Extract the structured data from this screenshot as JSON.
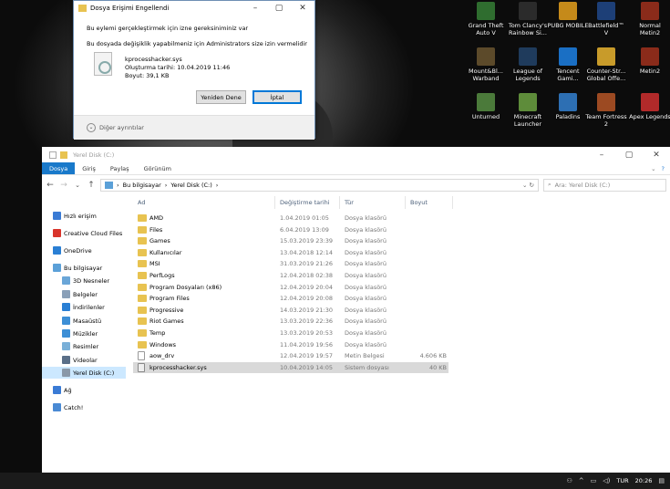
{
  "desktop_icons": [
    {
      "label": "Grand Theft Auto V",
      "color": "#2f6d2f",
      "icon": "gta-icon"
    },
    {
      "label": "Tom Clancy's Rainbow Si...",
      "color": "#2b2b2b",
      "icon": "rainbow-six-icon"
    },
    {
      "label": "PUBG MOBILE",
      "color": "#c58a1a",
      "icon": "pubg-icon"
    },
    {
      "label": "Battlefield™ V",
      "color": "#1d3f77",
      "icon": "battlefield-icon"
    },
    {
      "label": "Normal Metin2",
      "color": "#8a2b1a",
      "icon": "metin2-icon"
    },
    {
      "label": "Mount&Bl... Warband",
      "color": "#5c4a2a",
      "icon": "mount-blade-icon"
    },
    {
      "label": "League of Legends",
      "color": "#1f3b5c",
      "icon": "lol-icon"
    },
    {
      "label": "Tencent Gami...",
      "color": "#1a6fc4",
      "icon": "tencent-icon"
    },
    {
      "label": "Counter-Str... Global Offe...",
      "color": "#c89b2a",
      "icon": "csgo-icon"
    },
    {
      "label": "Metin2",
      "color": "#8a2b1a",
      "icon": "metin2-icon"
    },
    {
      "label": "Unturned",
      "color": "#4b7a3a",
      "icon": "unturned-icon"
    },
    {
      "label": "Minecraft Launcher",
      "color": "#5e8c3a",
      "icon": "minecraft-icon"
    },
    {
      "label": "Paladins",
      "color": "#2d6fb3",
      "icon": "paladins-icon"
    },
    {
      "label": "Team Fortress 2",
      "color": "#9c4a22",
      "icon": "tf2-icon"
    },
    {
      "label": "Apex Legends",
      "color": "#b22a2a",
      "icon": "apex-icon"
    }
  ],
  "dialog": {
    "title": "Dosya Erişimi Engellendi",
    "message1": "Bu eylemi gerçekleştirmek için izne gereksiniminiz var",
    "message2": "Bu dosyada değişiklik yapabilmeniz için Administrators size izin vermelidir",
    "file_name": "kprocesshacker.sys",
    "created": "Oluşturma tarihi: 10.04.2019 11:46",
    "size": "Boyut: 39,1 KB",
    "retry_label": "Yeniden Dene",
    "cancel_label": "İptal",
    "details_label": "Diğer ayrıntılar"
  },
  "explorer": {
    "title": "Yerel Disk (C:)",
    "tabs": [
      "Dosya",
      "Giriş",
      "Paylaş",
      "Görünüm"
    ],
    "breadcrumb": [
      "Bu bilgisayar",
      "Yerel Disk (C:)"
    ],
    "search_placeholder": "Ara: Yerel Disk (C:)",
    "columns": {
      "name": "Ad",
      "date": "Değiştirme tarihi",
      "type": "Tür",
      "size": "Boyut"
    },
    "nav": [
      {
        "label": "Hızlı erişim",
        "color": "#3a7bd5"
      },
      {
        "label": "Creative Cloud Files",
        "color": "#d9342b"
      },
      {
        "label": "OneDrive",
        "color": "#2a7fd4"
      },
      {
        "label": "Bu bilgisayar",
        "color": "#5ba0d8"
      },
      {
        "label": "3D Nesneler",
        "color": "#6aa6d8"
      },
      {
        "label": "Belgeler",
        "color": "#8aa0b8"
      },
      {
        "label": "İndirilenler",
        "color": "#2a7fd4"
      },
      {
        "label": "Masaüstü",
        "color": "#3d8fd6"
      },
      {
        "label": "Müzikler",
        "color": "#3d8fd6"
      },
      {
        "label": "Resimler",
        "color": "#7ab0d8"
      },
      {
        "label": "Videolar",
        "color": "#5a6f88"
      },
      {
        "label": "Yerel Disk (C:)",
        "color": "#8a98a8"
      },
      {
        "label": "Ağ",
        "color": "#3a7bd5"
      },
      {
        "label": "Catch!",
        "color": "#4a8ad4"
      }
    ],
    "files": [
      {
        "name": "AMD",
        "date": "1.04.2019 01:05",
        "type": "Dosya klasörü",
        "size": "",
        "kind": "folder"
      },
      {
        "name": "Files",
        "date": "6.04.2019 13:09",
        "type": "Dosya klasörü",
        "size": "",
        "kind": "folder"
      },
      {
        "name": "Games",
        "date": "15.03.2019 23:39",
        "type": "Dosya klasörü",
        "size": "",
        "kind": "folder"
      },
      {
        "name": "Kullanıcılar",
        "date": "13.04.2018 12:14",
        "type": "Dosya klasörü",
        "size": "",
        "kind": "folder"
      },
      {
        "name": "MSI",
        "date": "31.03.2019 21:26",
        "type": "Dosya klasörü",
        "size": "",
        "kind": "folder"
      },
      {
        "name": "PerfLogs",
        "date": "12.04.2018 02:38",
        "type": "Dosya klasörü",
        "size": "",
        "kind": "folder"
      },
      {
        "name": "Program Dosyaları (x86)",
        "date": "12.04.2019 20:04",
        "type": "Dosya klasörü",
        "size": "",
        "kind": "folder"
      },
      {
        "name": "Program Files",
        "date": "12.04.2019 20:08",
        "type": "Dosya klasörü",
        "size": "",
        "kind": "folder"
      },
      {
        "name": "Progressive",
        "date": "14.03.2019 21:30",
        "type": "Dosya klasörü",
        "size": "",
        "kind": "folder"
      },
      {
        "name": "Riot Games",
        "date": "13.03.2019 22:36",
        "type": "Dosya klasörü",
        "size": "",
        "kind": "folder"
      },
      {
        "name": "Temp",
        "date": "13.03.2019 20:53",
        "type": "Dosya klasörü",
        "size": "",
        "kind": "folder"
      },
      {
        "name": "Windows",
        "date": "11.04.2019 19:56",
        "type": "Dosya klasörü",
        "size": "",
        "kind": "folder"
      },
      {
        "name": "aow_drv",
        "date": "12.04.2019 19:57",
        "type": "Metin Belgesi",
        "size": "4.606 KB",
        "kind": "doc"
      },
      {
        "name": "kprocesshacker.sys",
        "date": "10.04.2019 14:05",
        "type": "Sistem dosyası",
        "size": "40 KB",
        "kind": "sys"
      }
    ]
  },
  "taskbar": {
    "language": "TUR",
    "time": "20:26"
  }
}
